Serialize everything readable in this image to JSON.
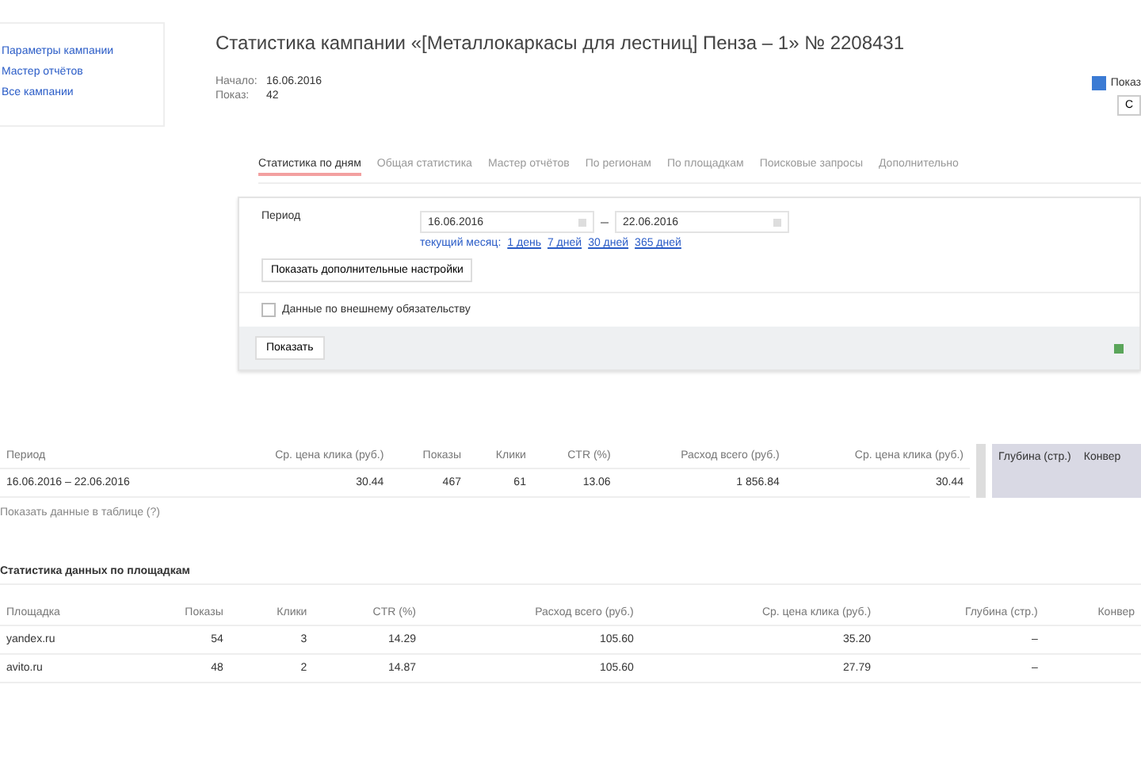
{
  "side_links": [
    "Параметры кампании",
    "Мастер отчётов",
    "Все кампании"
  ],
  "title": "Статистика кампании «[Металлокаркасы для лестниц] Пенза – 1» № 2208431",
  "info": [
    {
      "label": "Начало:",
      "value": "16.06.2016"
    },
    {
      "label": "Показ:",
      "value": "42"
    }
  ],
  "option": {
    "label": "Показ",
    "checked": true
  },
  "option_button": "С",
  "tabs": [
    {
      "label": "Статистика по дням",
      "selected": true
    },
    {
      "label": "Общая статистика",
      "selected": false
    },
    {
      "label": "Мастер отчётов",
      "selected": false
    },
    {
      "label": "По регионам",
      "selected": false
    },
    {
      "label": "По площадкам",
      "selected": false
    },
    {
      "label": "Поисковые запросы",
      "selected": false
    },
    {
      "label": "Дополнительно",
      "selected": false
    }
  ],
  "filter": {
    "period_label": "Период",
    "date_from": "16.06.2016",
    "date_to": "22.06.2016",
    "quick_label": "текущий месяц:",
    "quick": [
      "1 день",
      "7 дней",
      "30 дней",
      "365 дней"
    ],
    "more_button": "Показать дополнительные настройки",
    "checkbox": {
      "label": "Данные по внешнему обязательству",
      "checked": false
    },
    "show_button": "Показать"
  },
  "table": {
    "columns": [
      "Период",
      "Ср. цена клика (руб.)",
      "Показы",
      "Клики",
      "CTR (%)",
      "Расход всего (руб.)",
      "Ср. цена клика (руб.)"
    ],
    "rows": [
      [
        "16.06.2016 – 22.06.2016",
        "30.44",
        "467",
        "61",
        "13.06",
        "1 856.84",
        "30.44"
      ]
    ],
    "side_columns": [
      "Глубина (стр.)",
      "Конвер"
    ],
    "footnote": "Показать данные в таблице (?)"
  },
  "section_title": "Статистика данных по площадкам",
  "sites": {
    "columns": [
      "Площадка",
      "Показы",
      "Клики",
      "CTR (%)",
      "Расход всего (руб.)",
      "Ср. цена клика (руб.)",
      "Глубина (стр.)",
      "Конвер"
    ],
    "rows": [
      [
        "yandex.ru",
        "54",
        "3",
        "14.29",
        "105.60",
        "35.20",
        "–",
        ""
      ],
      [
        "avito.ru",
        "48",
        "2",
        "14.87",
        "105.60",
        "27.79",
        "–",
        ""
      ]
    ]
  }
}
